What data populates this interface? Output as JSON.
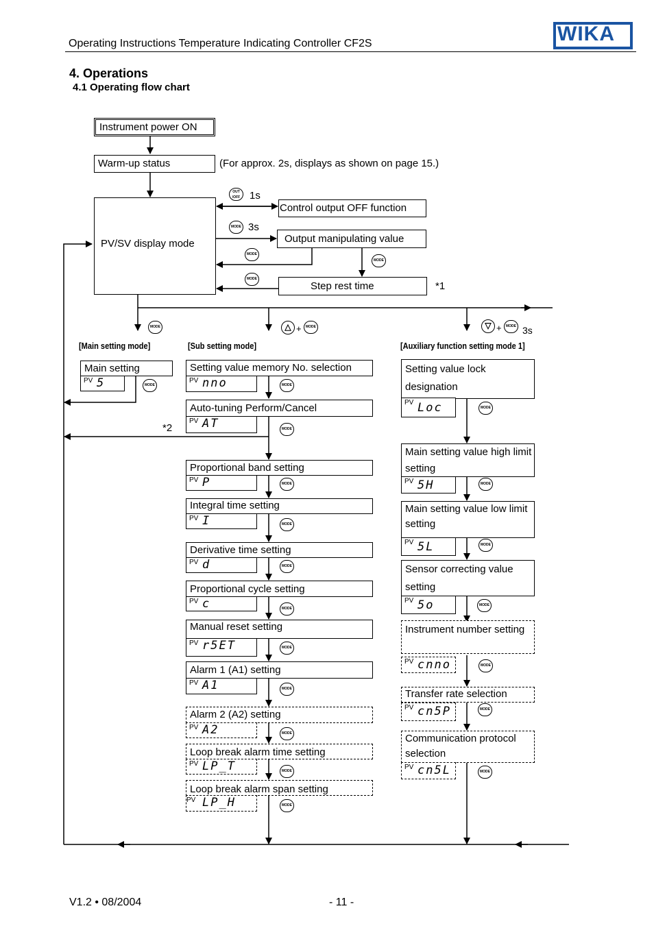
{
  "header": {
    "title": "Operating Instructions Temperature Indicating Controller CF2S",
    "logo_text": "WIKA",
    "brand_color": "#1a54a2"
  },
  "section": {
    "heading": "4. Operations",
    "subheading": "4.1 Operating flow chart"
  },
  "flow": {
    "power_on": "Instrument power ON",
    "warmup": "Warm-up status",
    "warmup_note": "(For approx. 2s, displays as shown on page 15.)",
    "pvsv": "PV/SV display mode",
    "control_output_off": "Control output OFF function",
    "output_manip": "Output manipulating value",
    "step_rest": "Step rest time",
    "note1": "*1",
    "note2": "*2",
    "outoff_time": "1s",
    "mode_time": "3s",
    "aux_time": "3s",
    "plus": "+",
    "keys": {
      "mode": "MODE",
      "outoff": "OUT/OFF",
      "up": "△",
      "down": "▽"
    }
  },
  "modes": {
    "main": {
      "title": "[Main setting mode]",
      "items": [
        {
          "label": "Main setting",
          "pv": "PV",
          "code": "5"
        }
      ]
    },
    "sub": {
      "title": "[Sub setting mode]",
      "items": [
        {
          "label": "Setting value memory No. selection",
          "pv": "PV",
          "code": "nno"
        },
        {
          "label": "Auto-tuning Perform/Cancel",
          "pv": "PV",
          "code": "AT"
        },
        {
          "label": "Proportional band setting",
          "pv": "PV",
          "code": "P"
        },
        {
          "label": "Integral time setting",
          "pv": "PV",
          "code": "I"
        },
        {
          "label": "Derivative time setting",
          "pv": "PV",
          "code": "d"
        },
        {
          "label": "Proportional cycle setting",
          "pv": "PV",
          "code": "c"
        },
        {
          "label": "Manual reset setting",
          "pv": "PV",
          "code": "r5ET"
        },
        {
          "label": "Alarm 1 (A1) setting",
          "pv": "PV",
          "code": "A1"
        },
        {
          "label": "Alarm 2 (A2) setting",
          "pv": "PV",
          "code": "A2"
        },
        {
          "label": "Loop break alarm time setting",
          "pv": "PV",
          "code": "LP_T"
        },
        {
          "label": "Loop break alarm span setting",
          "pv": "PV",
          "code": "LP_H"
        }
      ]
    },
    "aux": {
      "title": "[Auxiliary function setting mode 1]",
      "items": [
        {
          "label": "Setting value lock designation",
          "pv": "PV",
          "code": "Loc"
        },
        {
          "label": "Main setting value high limit setting",
          "pv": "PV",
          "code": "5H"
        },
        {
          "label": "Main setting value low limit setting",
          "pv": "PV",
          "code": "5L"
        },
        {
          "label": "Sensor correcting value setting",
          "pv": "PV",
          "code": "5o"
        },
        {
          "label": "Instrument number setting",
          "pv": "PV",
          "code": "cnno"
        },
        {
          "label": "Transfer rate selection",
          "pv": "PV",
          "code": "cn5P"
        },
        {
          "label": "Communication protocol selection",
          "pv": "PV",
          "code": "cn5L"
        }
      ]
    }
  },
  "footer": {
    "version": "V1.2 • 08/2004",
    "page": "- 11 -"
  }
}
